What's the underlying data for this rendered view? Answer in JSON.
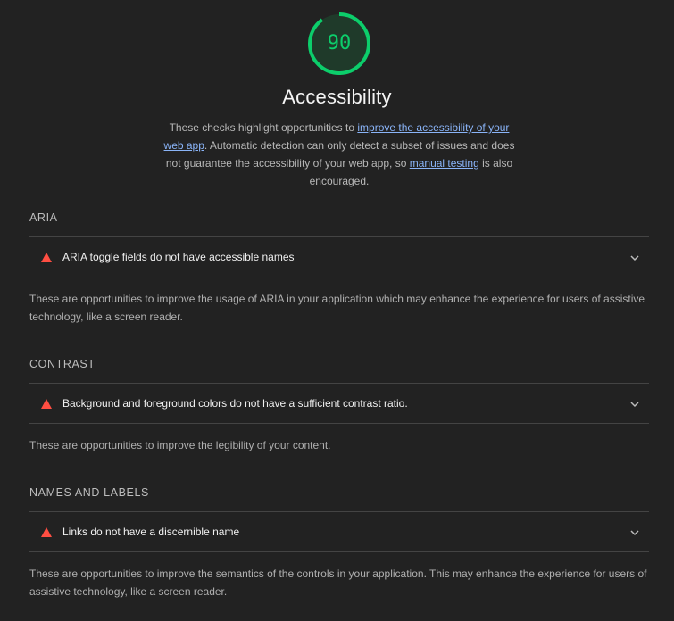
{
  "gauge": {
    "score": "90",
    "score_fraction": 0.9,
    "color": "#0cce6b"
  },
  "title": "Accessibility",
  "description": {
    "text1": "These checks highlight opportunities to ",
    "link1": "improve the accessibility of your web app",
    "text2": ". Automatic detection can only detect a subset of issues and does not guarantee the accessibility of your web app, so ",
    "link2": "manual testing",
    "text3": " is also encouraged."
  },
  "groups": [
    {
      "title": "ARIA",
      "audit": "ARIA toggle fields do not have accessible names",
      "description": "These are opportunities to improve the usage of ARIA in your application which may enhance the experience for users of assistive technology, like a screen reader."
    },
    {
      "title": "CONTRAST",
      "audit": "Background and foreground colors do not have a sufficient contrast ratio.",
      "description": "These are opportunities to improve the legibility of your content."
    },
    {
      "title": "NAMES AND LABELS",
      "audit": "Links do not have a discernible name",
      "description": "These are opportunities to improve the semantics of the controls in your application. This may enhance the experience for users of assistive technology, like a screen reader."
    }
  ],
  "colors": {
    "fail": "#ff4e42",
    "link": "#8ab4f8",
    "background": "#222222"
  },
  "icons": {
    "fail": "fail-triangle-icon",
    "expand": "chevron-down-icon"
  }
}
